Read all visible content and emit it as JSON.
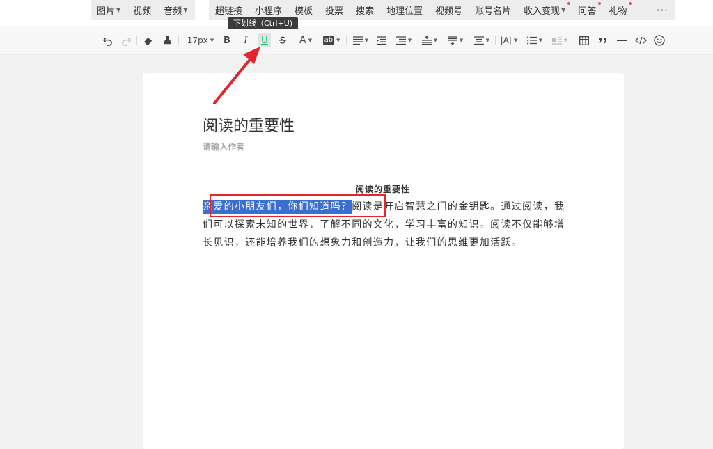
{
  "insert_bar": {
    "group1": [
      {
        "label": "图片",
        "caret": true
      },
      {
        "label": "视频",
        "caret": false
      },
      {
        "label": "音频",
        "caret": true
      }
    ],
    "group2": [
      {
        "label": "超链接",
        "caret": false,
        "dot": false
      },
      {
        "label": "小程序",
        "caret": false,
        "dot": false
      },
      {
        "label": "模板",
        "caret": false,
        "dot": false
      },
      {
        "label": "投票",
        "caret": false,
        "dot": false
      },
      {
        "label": "搜索",
        "caret": false,
        "dot": false
      },
      {
        "label": "地理位置",
        "caret": false,
        "dot": false
      },
      {
        "label": "视频号",
        "caret": false,
        "dot": false
      },
      {
        "label": "账号名片",
        "caret": false,
        "dot": false
      },
      {
        "label": "收入变现",
        "caret": true,
        "dot": true
      },
      {
        "label": "问答",
        "caret": false,
        "dot": true
      },
      {
        "label": "礼物",
        "caret": false,
        "dot": true
      }
    ],
    "more": "···"
  },
  "toolbar": {
    "font_size": "17px",
    "bold": "B",
    "italic": "I",
    "underline": "U",
    "font_color": "A",
    "bg_color": "ab",
    "letter_spacing": "|A|"
  },
  "tooltip": "下划线（Ctrl+U)",
  "editor": {
    "title": "阅读的重要性",
    "author_placeholder": "请输入作者",
    "heading": "阅读的重要性",
    "selected_text": "亲爱的小朋友们，你们知道吗？",
    "rest_text": "阅读是开启智慧之门的金钥匙。通过阅读，我们可以探索未知的世界，了解不同的文化，学习丰富的知识。阅读不仅能够增长见识，还能培养我们的想象力和创造力，让我们的思维更加活跃。"
  },
  "colors": {
    "selection": "#3a6fd1",
    "annotation": "#e5242b",
    "underline_icon": "#07c160"
  }
}
